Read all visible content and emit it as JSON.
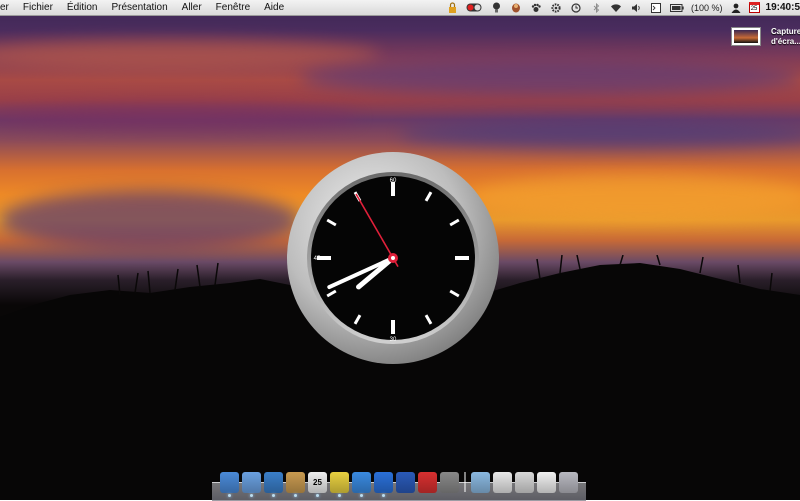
{
  "menubar": {
    "app_menu": "er",
    "menus": [
      "Fichier",
      "Édition",
      "Présentation",
      "Aller",
      "Fenêtre",
      "Aide"
    ],
    "status": {
      "battery_text": "(100 %)",
      "calendar_day": "25",
      "clock": "19:40:5"
    }
  },
  "desktop": {
    "screenshot_file": {
      "label_line1": "Capture",
      "label_line2": "d'écra..."
    }
  },
  "clock_widget": {
    "time": "19:40:55",
    "hour": 19,
    "minute": 40,
    "second": 55,
    "dial_labels": {
      "top": "60",
      "left": "45",
      "bottom": "30"
    },
    "colors": {
      "face": "#050505",
      "bezel": "#c8c8c8",
      "second_hand": "#e0203a",
      "hands": "#ffffff"
    }
  },
  "dock": {
    "items": [
      {
        "name": "finder-icon",
        "color": "#4a8ad8"
      },
      {
        "name": "mail-icon",
        "color": "#6aa0e0"
      },
      {
        "name": "safari-icon",
        "color": "#3a7ec8"
      },
      {
        "name": "address-book-icon",
        "color": "#c89a50"
      },
      {
        "name": "ical-icon",
        "color": "#eeeeee",
        "text": "25"
      },
      {
        "name": "stickies-icon",
        "color": "#e8d040"
      },
      {
        "name": "itunes-icon",
        "color": "#3a8ae0"
      },
      {
        "name": "app-store-icon",
        "color": "#2a70d8"
      },
      {
        "name": "network-globe-icon",
        "color": "#2a5ab8"
      },
      {
        "name": "hydrant-icon",
        "color": "#d83030"
      },
      {
        "name": "photo-browser-icon",
        "color": "#888888"
      },
      {
        "name": "folder-icon",
        "color": "#8ab8e0"
      },
      {
        "name": "document-icon",
        "color": "#e8e8e8"
      },
      {
        "name": "preview-icon",
        "color": "#d8d8d8"
      },
      {
        "name": "envelope-icon",
        "color": "#f0f0f0"
      },
      {
        "name": "trash-icon",
        "color": "#b8b8c0"
      }
    ]
  }
}
